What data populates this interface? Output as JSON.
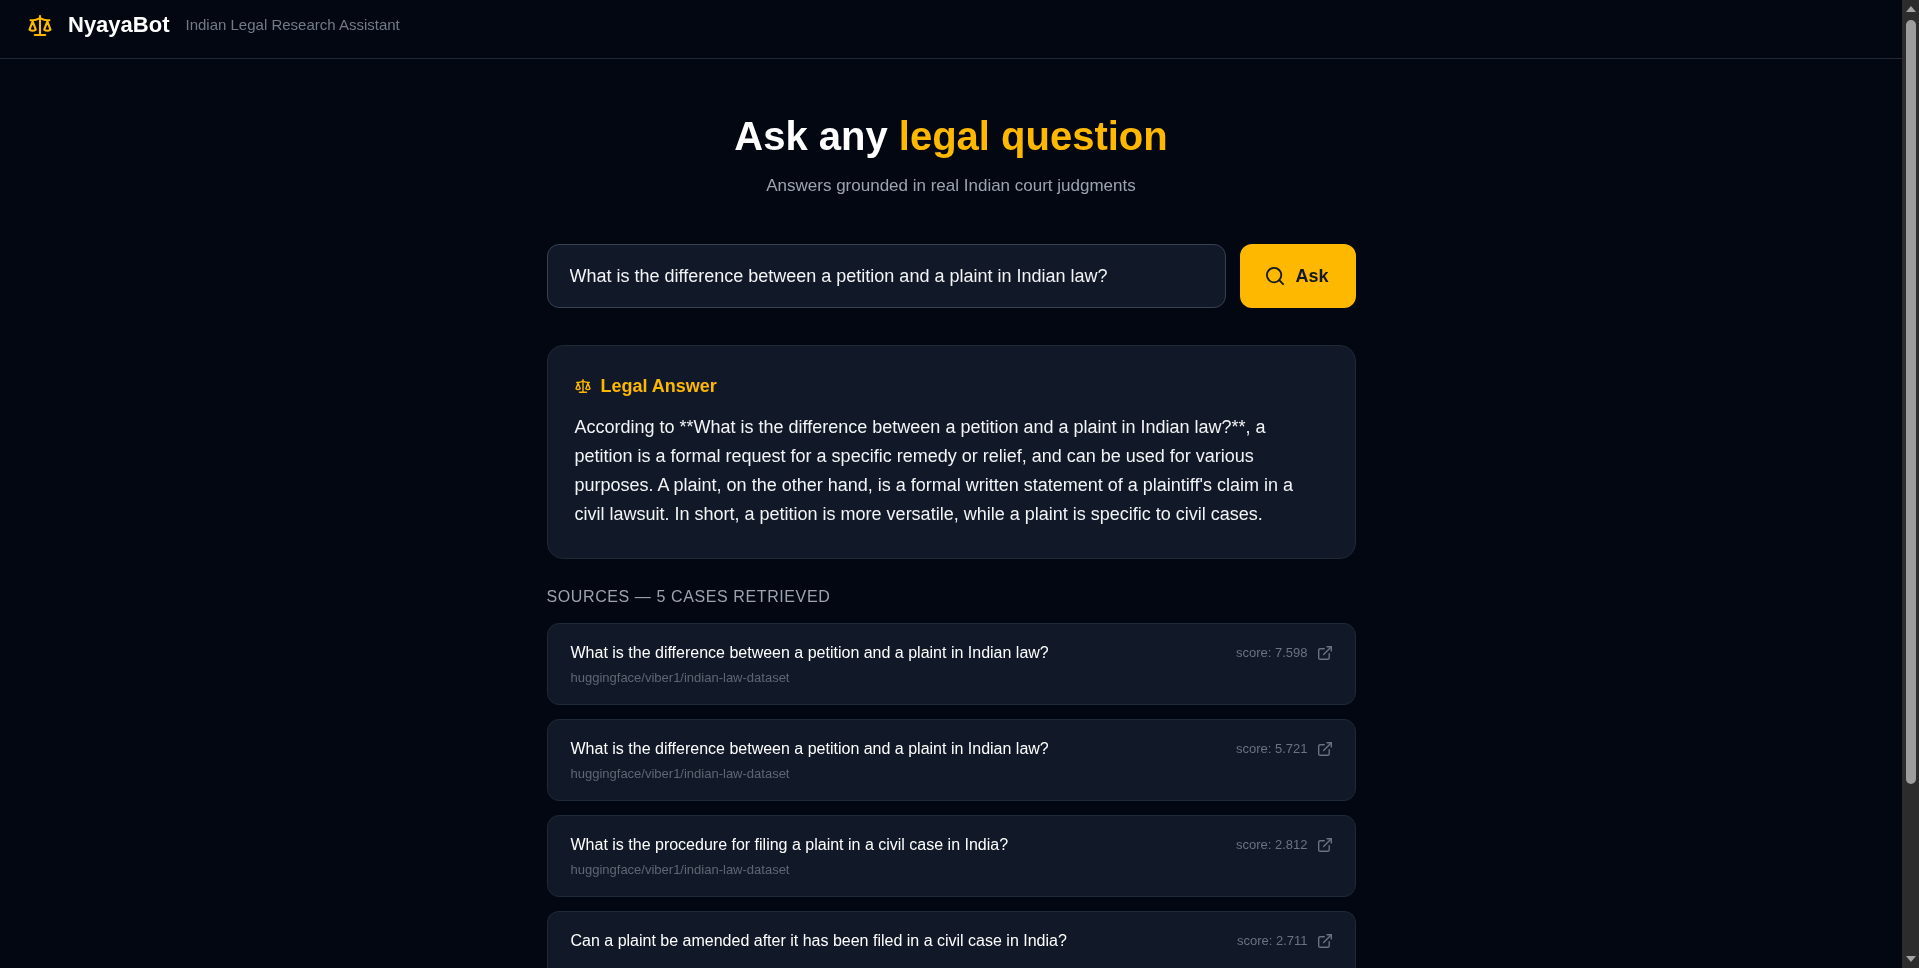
{
  "header": {
    "app_name": "NyayaBot",
    "tagline": "Indian Legal Research Assistant"
  },
  "hero": {
    "title": "Ask any",
    "title_highlight": "legal question",
    "subtitle": "Answers grounded in real Indian court judgments"
  },
  "search": {
    "value": "What is the difference between a petition and a plaint in Indian law?",
    "button": "Ask"
  },
  "answer": {
    "heading": "Legal Answer",
    "text": "According to **What is the difference between a petition and a plaint in Indian law?**, a petition is a formal request for a specific remedy or relief, and can be used for various purposes. A plaint, on the other hand, is a formal written statement of a plaintiff's claim in a civil lawsuit. In short, a petition is more versatile, while a plaint is specific to civil cases."
  },
  "sources": {
    "heading": "SOURCES — 5 CASES RETRIEVED",
    "items": [
      {
        "title": "What is the difference between a petition and a plaint in Indian law?",
        "source": "huggingface/viber1/indian-law-dataset",
        "score": "score: 7.598"
      },
      {
        "title": "What is the difference between a petition and a plaint in Indian law?",
        "source": "huggingface/viber1/indian-law-dataset",
        "score": "score: 5.721"
      },
      {
        "title": "What is the procedure for filing a plaint in a civil case in India?",
        "source": "huggingface/viber1/indian-law-dataset",
        "score": "score: 2.812"
      },
      {
        "title": "Can a plaint be amended after it has been filed in a civil case in India?",
        "score": "score: 2.711"
      }
    ]
  }
}
